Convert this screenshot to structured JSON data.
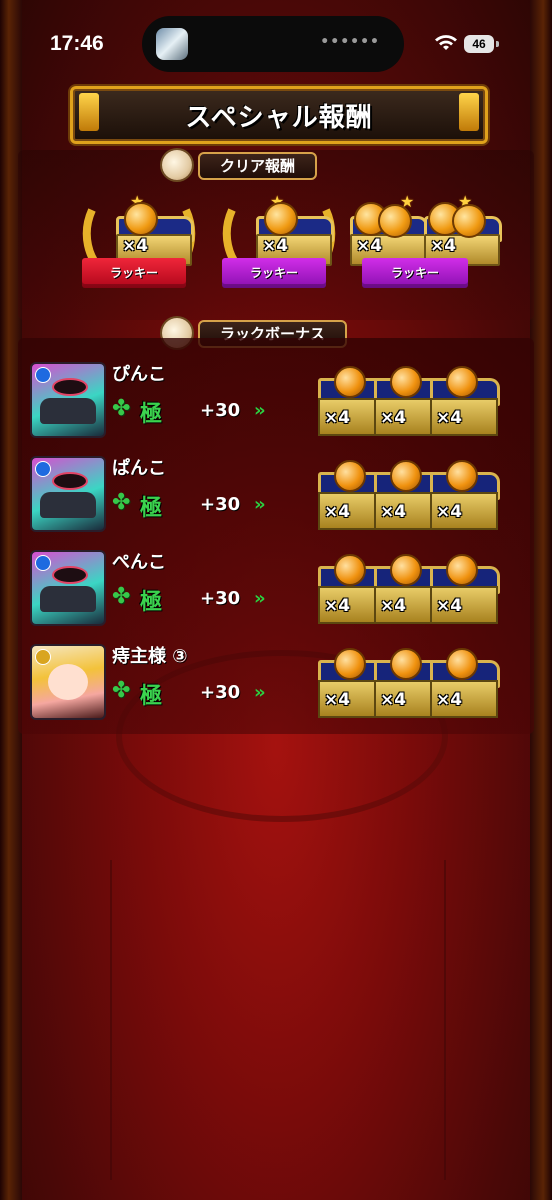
{
  "status_bar": {
    "time": "17:46",
    "dots": "••••••",
    "battery": "46"
  },
  "title": "スペシャル報酬",
  "clear_reward": {
    "header": "クリア報酬",
    "items": [
      {
        "multiplier": "×4",
        "ribbon": "ラッキー",
        "ribbon_color": "#e0152a"
      },
      {
        "multiplier": "×4",
        "ribbon": "ラッキー",
        "ribbon_color": "#b41fd6"
      },
      {
        "multiplier": "×4",
        "multiplier_2": "×4",
        "ribbon": "ラッキー",
        "ribbon_color": "#b41fd6"
      }
    ]
  },
  "luck_bonus": {
    "header": "ラックボーナス",
    "players": [
      {
        "name": "ぴんこ",
        "clover": "✤",
        "rank": "極",
        "bonus": "+30",
        "arrow": "»",
        "chests": [
          "×4",
          "×4",
          "×4"
        ]
      },
      {
        "name": "ぱんこ",
        "clover": "✤",
        "rank": "極",
        "bonus": "+30",
        "arrow": "»",
        "chests": [
          "×4",
          "×4",
          "×4"
        ]
      },
      {
        "name": "ぺんこ",
        "clover": "✤",
        "rank": "極",
        "bonus": "+30",
        "arrow": "»",
        "chests": [
          "×4",
          "×4",
          "×4"
        ]
      },
      {
        "name": "痔主様 ③",
        "clover": "✤",
        "rank": "極",
        "bonus": "+30",
        "arrow": "»",
        "chests": [
          "×4",
          "×4",
          "×4"
        ]
      }
    ]
  }
}
